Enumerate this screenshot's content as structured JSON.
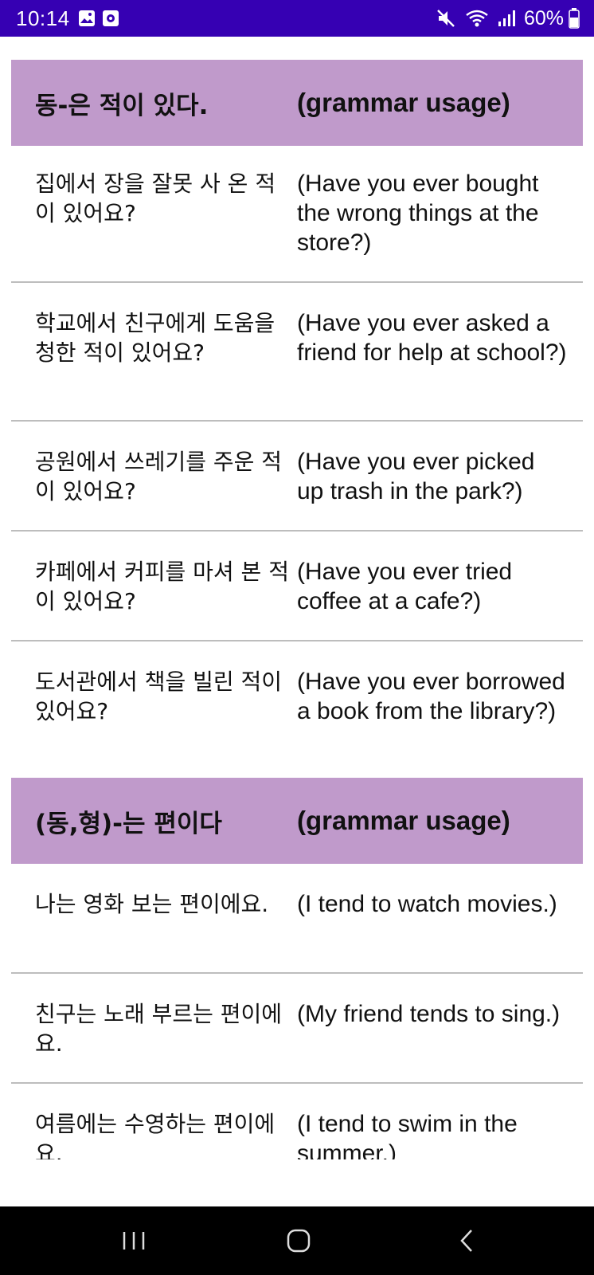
{
  "status_bar": {
    "time": "10:14",
    "battery": "60%",
    "icons": [
      "image-icon",
      "record-icon",
      "mute-icon",
      "wifi-icon",
      "signal-icon",
      "battery-icon"
    ]
  },
  "sections": [
    {
      "header_left": "동-은 적이 있다.",
      "header_right": "(grammar usage)",
      "rows": [
        {
          "korean": "집에서 장을 잘못 사 온 적이 있어요?",
          "english": "(Have you ever bought the wrong things at the store?)"
        },
        {
          "korean": "학교에서 친구에게 도움을 청한 적이 있어요?",
          "english": "(Have you ever asked a friend for help at school?)"
        },
        {
          "korean": "공원에서 쓰레기를 주운 적이 있어요?",
          "english": "(Have you ever picked up trash in the park?)"
        },
        {
          "korean": "카페에서 커피를 마셔 본 적이 있어요?",
          "english": "(Have you ever tried coffee at a cafe?)"
        },
        {
          "korean": "도서관에서 책을 빌린 적이 있어요?",
          "english": "(Have you ever borrowed a book from the library?)"
        }
      ]
    },
    {
      "header_left": "(동,형)-는 편이다",
      "header_right": "(grammar usage)",
      "rows": [
        {
          "korean": "나는 영화 보는 편이에요.",
          "english": "(I tend to watch movies.)"
        },
        {
          "korean": "친구는 노래 부르는 편이에요.",
          "english": "(My friend tends to sing.)"
        },
        {
          "korean": "여름에는 수영하는 편이에요.",
          "english": "(I tend to swim in the summer.)"
        }
      ]
    }
  ],
  "nav_bar": {
    "buttons": [
      "recent-apps-button",
      "home-button",
      "back-button"
    ]
  }
}
